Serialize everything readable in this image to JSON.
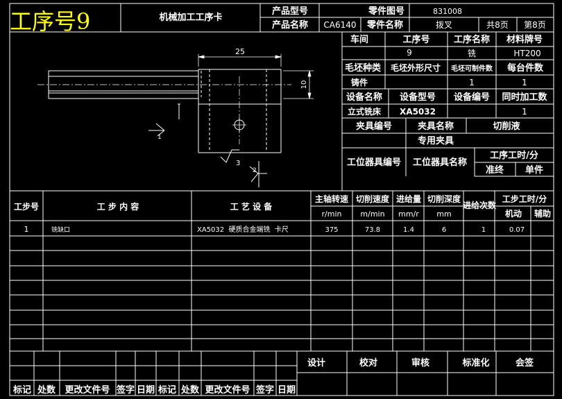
{
  "header": {
    "title": "工序号9",
    "card_name": "机械加工工序卡",
    "product_model_label": "产品型号",
    "product_model_value": "",
    "part_drawing_no_label": "零件图号",
    "part_drawing_no_value": "831008",
    "product_name_label": "产品名称",
    "product_name_value": "CA6140",
    "part_name_label": "零件名称",
    "part_name_value": "拨叉",
    "total_pages": "共8页",
    "page_no": "第8页"
  },
  "info": {
    "workshop_label": "车间",
    "process_no_label": "工序号",
    "process_name_label": "工序名称",
    "material_label": "材料牌号",
    "process_no_value": "9",
    "process_name_value": "铣",
    "material_value": "HT200",
    "blank_type_label": "毛坯种类",
    "blank_size_label": "毛坯外形尺寸",
    "blank_parts_label": "毛坯可制件数",
    "parts_per_unit_label": "每台件数",
    "blank_type_value": "铸件",
    "blank_parts_value": "1",
    "parts_per_unit_value": "1",
    "equip_name_label": "设备名称",
    "equip_model_label": "设备型号",
    "equip_no_label": "设备编号",
    "simul_label": "同时加工数",
    "equip_name_value": "立式铣床",
    "equip_model_value": "XA5032",
    "simul_value": "1",
    "fixture_no_label": "夹具编号",
    "fixture_name_label": "夹具名称",
    "coolant_label": "切削液",
    "fixture_name_value": "专用夹具",
    "station_no_label": "工位器具编号",
    "station_name_label": "工位器具名称",
    "time_label": "工序工时/分",
    "time_final_label": "准终",
    "time_unit_label": "单件"
  },
  "drawing": {
    "dim_25": "25",
    "dim_10": "10",
    "dim_3": "3",
    "mark_1": "1",
    "mark_2": "2"
  },
  "steps_header": {
    "step_no": "工步号",
    "step_content": "工 步 内 容",
    "equipment": "工 艺 设 备",
    "spindle": "主轴转速",
    "speed": "切削速度",
    "feed": "进给量",
    "depth": "切削深度",
    "passes": "进给次数",
    "step_time": "工步工时/分",
    "unit_spindle": "r/min",
    "unit_speed": "m/min",
    "unit_feed": "mm/r",
    "unit_depth": "mm",
    "machine": "机动",
    "aux": "辅助"
  },
  "steps": [
    {
      "no": "1",
      "content": "铣缺口",
      "equipment": "XA5032  硬质合金端铣  卡尺",
      "spindle": "375",
      "speed": "73.8",
      "feed": "1.4",
      "depth": "6",
      "passes": "1",
      "machine": "0.07",
      "aux": ""
    }
  ],
  "footer": {
    "design": "设计",
    "check": "校对",
    "review": "审核",
    "standard": "标准化",
    "sign": "会签",
    "mark": "标记",
    "count": "处数",
    "change_doc": "更改文件号",
    "signature": "签字",
    "date": "日期"
  }
}
